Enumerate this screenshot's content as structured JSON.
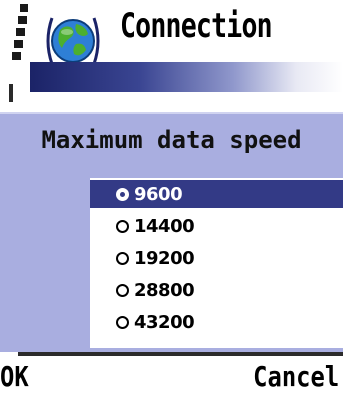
{
  "header": {
    "title": "Connection",
    "band_colors": [
      "#1b2367",
      "#3a4592",
      "#9098cc",
      "#ffffff"
    ]
  },
  "dialog": {
    "title": "Maximum data speed",
    "background": "#a9aee0",
    "selected_color": "#333a86",
    "options": [
      {
        "label": "9600",
        "selected": true
      },
      {
        "label": "14400",
        "selected": false
      },
      {
        "label": "19200",
        "selected": false
      },
      {
        "label": "28800",
        "selected": false
      },
      {
        "label": "43200",
        "selected": false
      }
    ]
  },
  "softkeys": {
    "left": "OK",
    "right": "Cancel"
  },
  "icons": [
    "signal-strength-icon",
    "globe-icon",
    "antenna-icon",
    "radio-icon"
  ]
}
